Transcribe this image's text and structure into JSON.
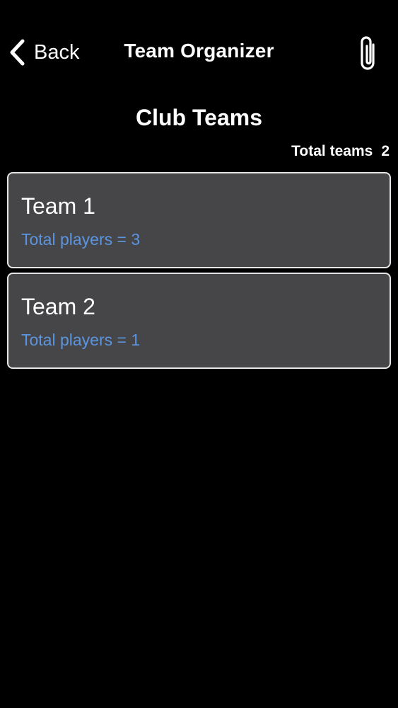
{
  "nav": {
    "back_label": "Back",
    "title": "Team Organizer",
    "back_icon": "chevron-left-icon",
    "attach_icon": "paperclip-icon"
  },
  "page": {
    "title": "Club Teams",
    "total_teams_label": "Total teams",
    "total_teams_value": "2"
  },
  "teams": [
    {
      "name": "Team 1",
      "players_text": "Total players = 3"
    },
    {
      "name": "Team 2",
      "players_text": "Total players = 1"
    }
  ],
  "colors": {
    "background": "#000000",
    "card_background": "#464548",
    "card_border": "#e6e6e6",
    "players_text": "#5b95e0",
    "primary_text": "#ffffff"
  }
}
